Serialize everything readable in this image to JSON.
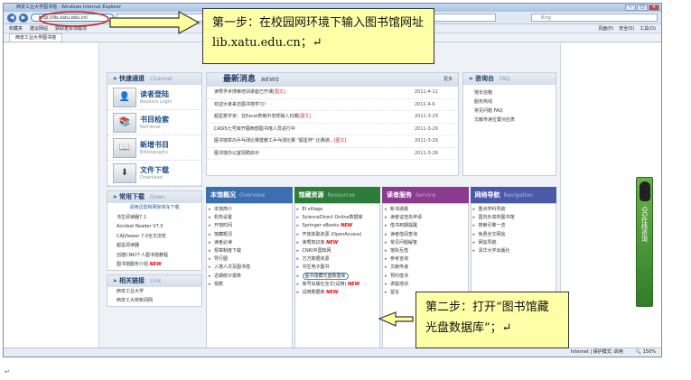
{
  "browser": {
    "title": "西安工业大学图书馆 - Windows Internet Explorer",
    "url": "http://lib.xatu.edu.cn/",
    "search_placeholder": "Bing",
    "favorites": [
      "收藏夹",
      "建议网站",
      "获取更多加载项"
    ],
    "tab_title": "西安工业大学图书馆",
    "tools": [
      "页面(P)",
      "安全(S)",
      "工具(O)"
    ],
    "status_zone": "Internet | 保护模式: 启用",
    "zoom": "150%"
  },
  "callouts": {
    "step1": "第一步：在校园网环境下输入图书馆网址 lib.xatu.edu.cn；↵",
    "step2": "第二步：打开“图书馆藏光盘数据库”；↵"
  },
  "quick": {
    "title": "快速通道",
    "title_en": "Channel",
    "items": [
      {
        "t": "读者登陆",
        "s": "Readers Login"
      },
      {
        "t": "书目检索",
        "s": "Retrieval"
      },
      {
        "t": "新增书目",
        "s": "Bibliography"
      },
      {
        "t": "文件下载",
        "s": "Download"
      }
    ]
  },
  "downloads": {
    "title": "常用下载",
    "title_en": "Down",
    "top": "请用迅雷和网际快车下载",
    "items": [
      "书生阅读器7.1",
      "Acrobat Reader V7.0",
      "CAJViewer 7.0全文浏览",
      "超星阅读器",
      "创建CNKI个人图书馆教程",
      "图书馆服务介绍"
    ]
  },
  "links": {
    "title": "相关链接",
    "title_en": "Link",
    "items": [
      "西安工业大学",
      "西安工大校新闻网"
    ]
  },
  "news": {
    "title": "最新消息",
    "title_en": "NEWS",
    "more": "更多",
    "items": [
      {
        "t": "读秀学术搜索培训讲座已开课",
        "tag": "[图文]",
        "d": "2011-4-11"
      },
      {
        "t": "欢迎大家来访图书馆学习！",
        "tag": "",
        "d": "2011-4-6"
      },
      {
        "t": "超星数字资：在Excel表格中怎样输入日期",
        "tag": "[图文]",
        "d": "2011-3-29"
      },
      {
        "t": "CASIS七号库开展西部图书馆人员进行中",
        "tag": "",
        "d": "2011-3-29"
      },
      {
        "t": "图书馆举办乒乓球比赛暨教工乒乓球比赛 \"超星杯\" 比赛通...",
        "tag": "[图文]",
        "d": "2011-3-29"
      },
      {
        "t": "图书馆办公室招聘启示",
        "tag": "",
        "d": "2011-3-28"
      }
    ]
  },
  "desk": {
    "title": "咨询台",
    "title_en": "FAQ",
    "items": [
      "馆长信箱",
      "服务热线",
      "常见问题 FAQ",
      "文献传递位置对应表"
    ]
  },
  "tabs": [
    {
      "label": "本馆概况",
      "en": "Overview",
      "color": "#3c6fb0"
    },
    {
      "label": "馆藏资源",
      "en": "Resources",
      "color": "#2d7d3a"
    },
    {
      "label": "读者服务",
      "en": "Service",
      "color": "#8a3b8f"
    },
    {
      "label": "网络导航",
      "en": "Navigation",
      "color": "#4a5aa8"
    }
  ],
  "overview": [
    "本馆简介",
    "机构设置",
    "开馆时间",
    "馆藏概况",
    "读者必读",
    "规章制度下载",
    "导行图",
    "入馆人次及图书借",
    "近期统计报表",
    "捐赠"
  ],
  "resources": [
    "EI village",
    "ScienceDirect Online数据库",
    "Springer eBooks",
    "开放获取资源 (OpenAccess)",
    "读秀知识库",
    "CNKI中国知网",
    "万方数据资源",
    "书生电子图书",
    "图书馆藏光盘数据库",
    "库号出版社全文(试用)",
    "试用数据库"
  ],
  "service": [
    "新书通报",
    "读者证挂失申请",
    "借书到期提醒",
    "读者借阅查询",
    "常见问题解答",
    "馆际互借",
    "参考咨询",
    "文献传递",
    "预约借书",
    "讲座培训",
    "留言"
  ],
  "navigation": [
    "重点学科导航",
    "国内外高校图书馆",
    "搜索引擎一览",
    "免费全文网站",
    "网站导航",
    "清华大学出版社"
  ],
  "qq": "QQ在线咨询",
  "paragraph_mark": "↵"
}
